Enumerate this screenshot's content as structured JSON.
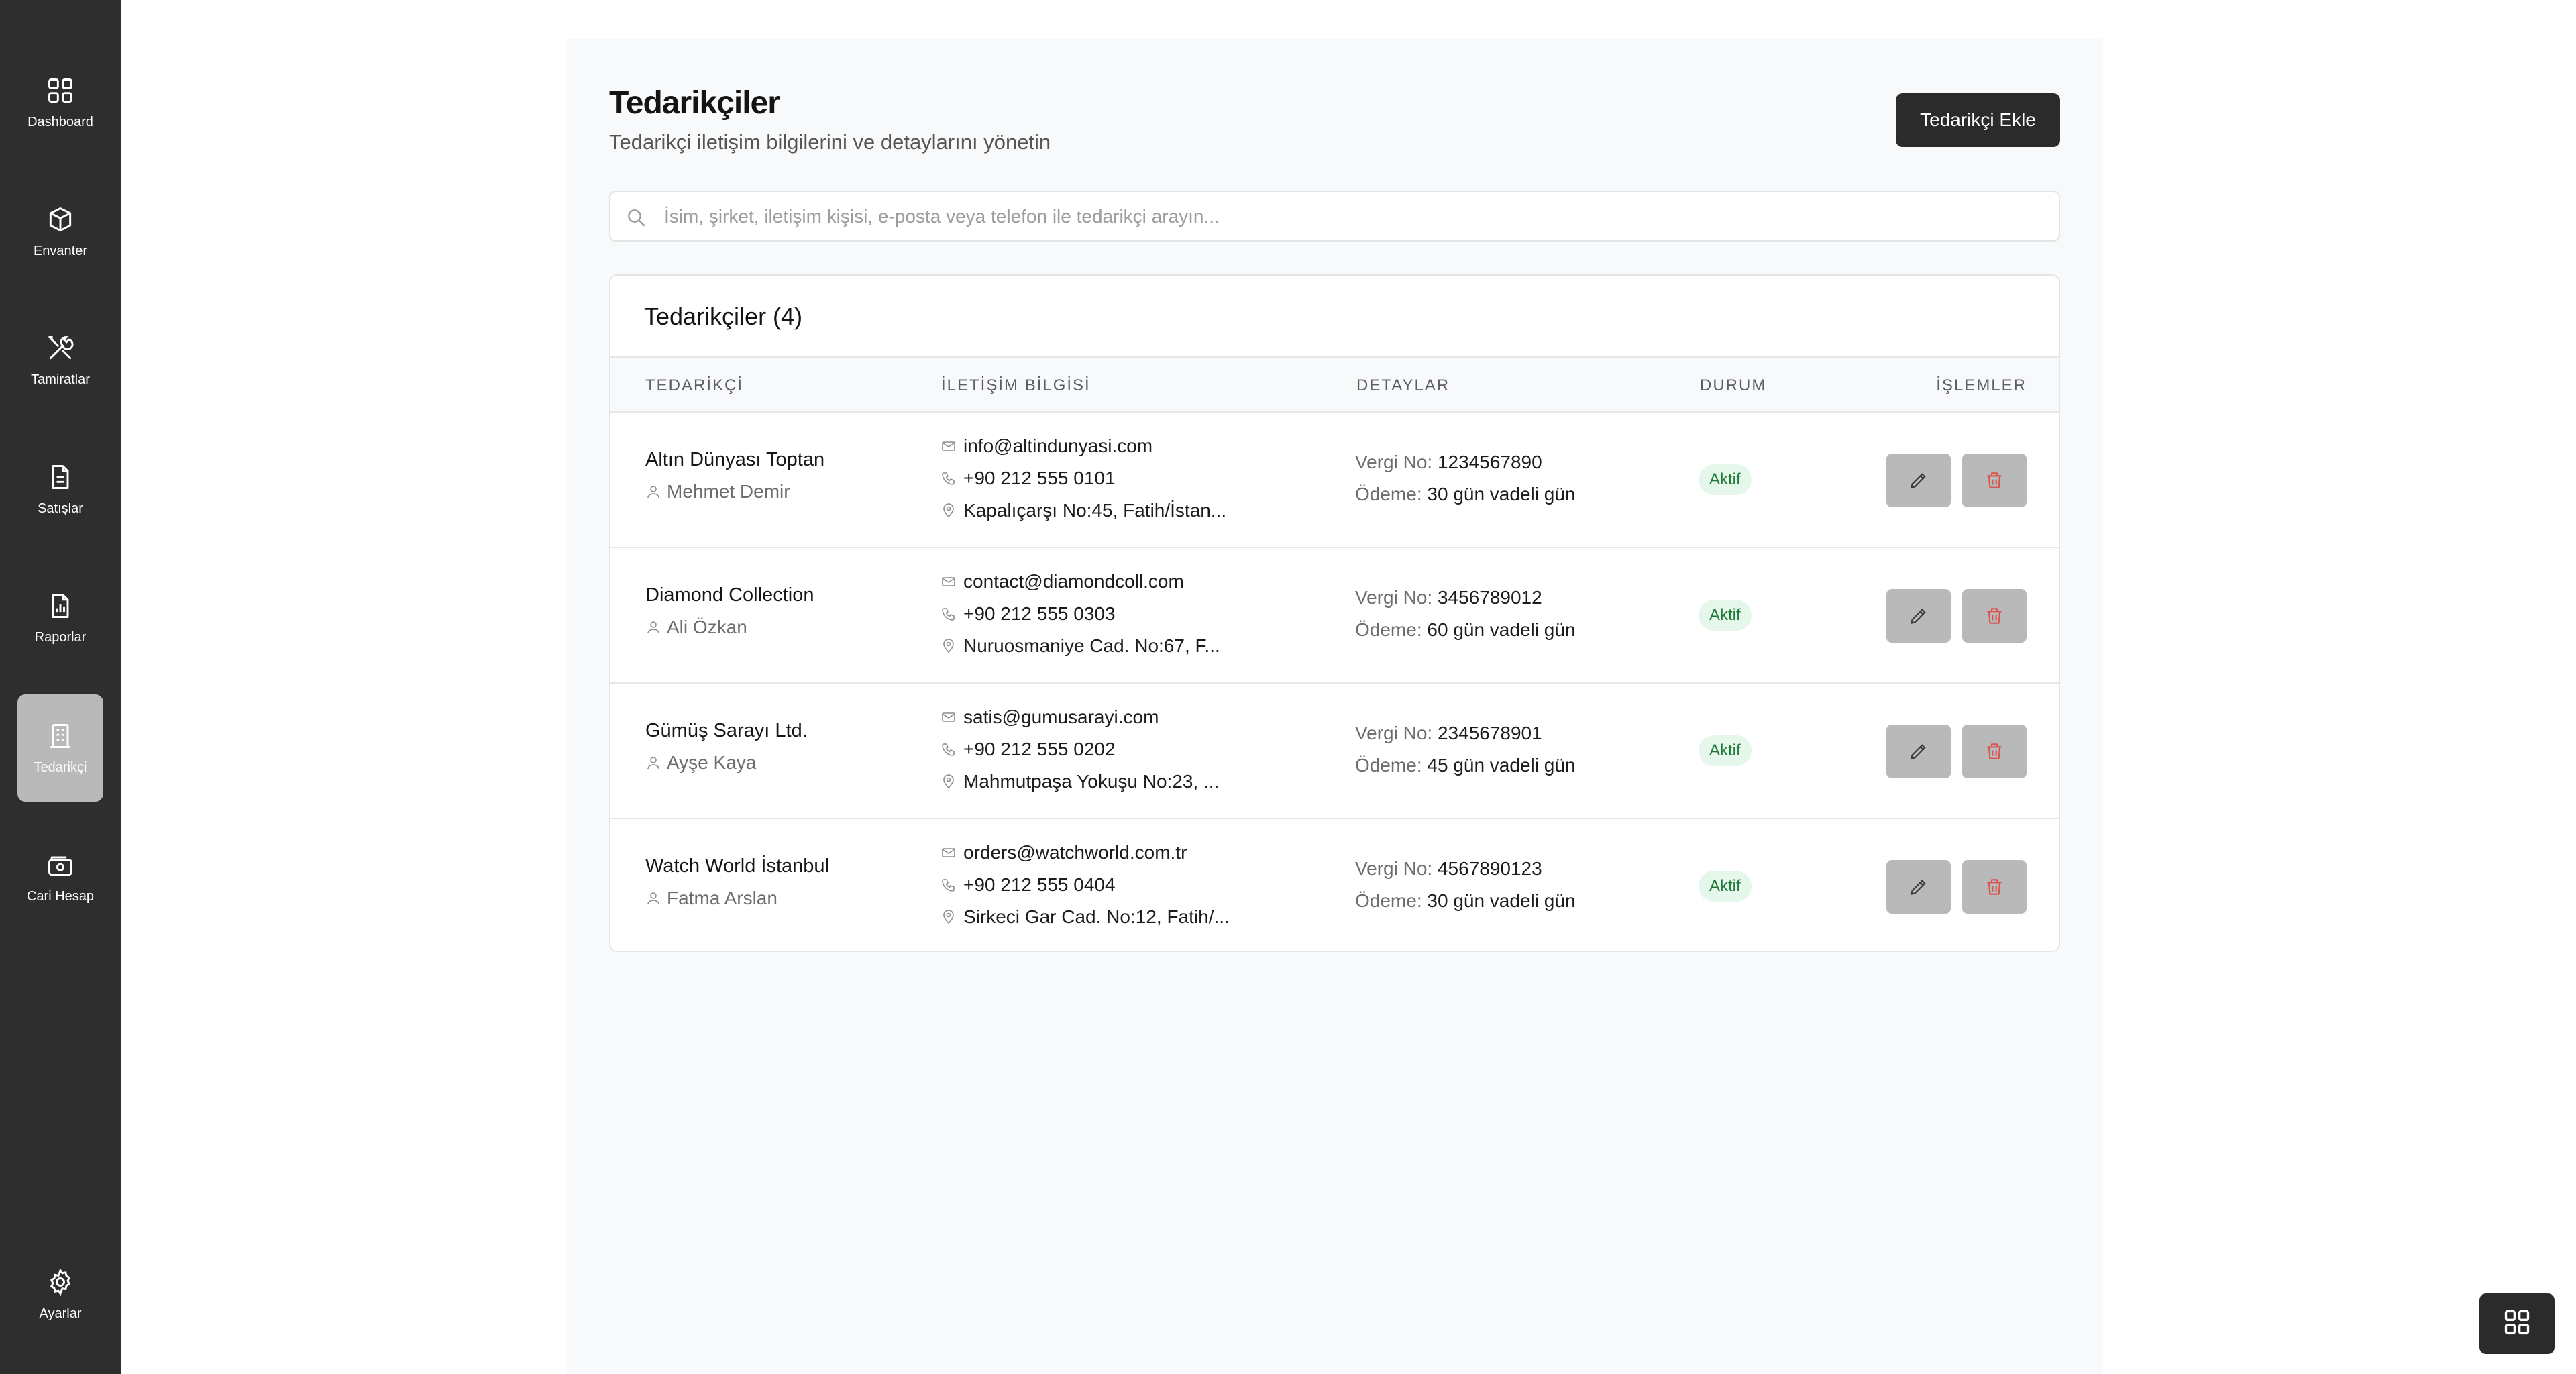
{
  "sidebar": {
    "items": [
      {
        "label": "Dashboard",
        "icon": "grid-icon",
        "active": false
      },
      {
        "label": "Envanter",
        "icon": "box-icon",
        "active": false
      },
      {
        "label": "Tamiratlar",
        "icon": "tools-icon",
        "active": false
      },
      {
        "label": "Satışlar",
        "icon": "document-icon",
        "active": false
      },
      {
        "label": "Raporlar",
        "icon": "chart-report-icon",
        "active": false
      },
      {
        "label": "Tedarikçi",
        "icon": "building-icon",
        "active": true
      },
      {
        "label": "Cari Hesap",
        "icon": "wallet-icon",
        "active": false
      }
    ],
    "settings": {
      "label": "Ayarlar",
      "icon": "gear-icon"
    }
  },
  "header": {
    "title": "Tedarikçiler",
    "subtitle": "Tedarikçi iletişim bilgilerini ve detaylarını yönetin",
    "add_button": "Tedarikçi Ekle"
  },
  "search": {
    "placeholder": "İsim, şirket, iletişim kişisi, e-posta veya telefon ile tedarikçi arayın...",
    "value": ""
  },
  "table": {
    "title": "Tedarikçiler (4)",
    "columns": {
      "supplier": "TEDARİKÇİ",
      "contact": "İLETİŞİM BİLGİSİ",
      "details": "DETAYLAR",
      "status": "DURUM",
      "actions": "İŞLEMLER"
    },
    "tax_label": "Vergi No:",
    "payment_label": "Ödeme:",
    "rows": [
      {
        "name": "Altın Dünyası Toptan",
        "person": "Mehmet Demir",
        "email": "info@altindunyasi.com",
        "phone": "+90 212 555 0101",
        "address": "Kapalıçarşı No:45, Fatih/İstan...",
        "tax_no": "1234567890",
        "payment": "30 gün vadeli gün",
        "status": "Aktif"
      },
      {
        "name": "Diamond Collection",
        "person": "Ali Özkan",
        "email": "contact@diamondcoll.com",
        "phone": "+90 212 555 0303",
        "address": "Nuruosmaniye Cad. No:67, F...",
        "tax_no": "3456789012",
        "payment": "60 gün vadeli gün",
        "status": "Aktif"
      },
      {
        "name": "Gümüş Sarayı Ltd.",
        "person": "Ayşe Kaya",
        "email": "satis@gumusarayi.com",
        "phone": "+90 212 555 0202",
        "address": "Mahmutpaşa Yokuşu No:23, ...",
        "tax_no": "2345678901",
        "payment": "45 gün vadeli gün",
        "status": "Aktif"
      },
      {
        "name": "Watch World İstanbul",
        "person": "Fatma Arslan",
        "email": "orders@watchworld.com.tr",
        "phone": "+90 212 555 0404",
        "address": "Sirkeci Gar Cad. No:12, Fatih/...",
        "tax_no": "4567890123",
        "payment": "30 gün vadeli gün",
        "status": "Aktif"
      }
    ]
  },
  "colors": {
    "sidebar_bg": "#2e2e2e",
    "active_item": "#b9b9b9",
    "primary_button": "#2b2b2b",
    "status_badge_bg": "#e5f6ea",
    "status_badge_text": "#1f7a3a",
    "delete_icon": "#d9534f"
  }
}
